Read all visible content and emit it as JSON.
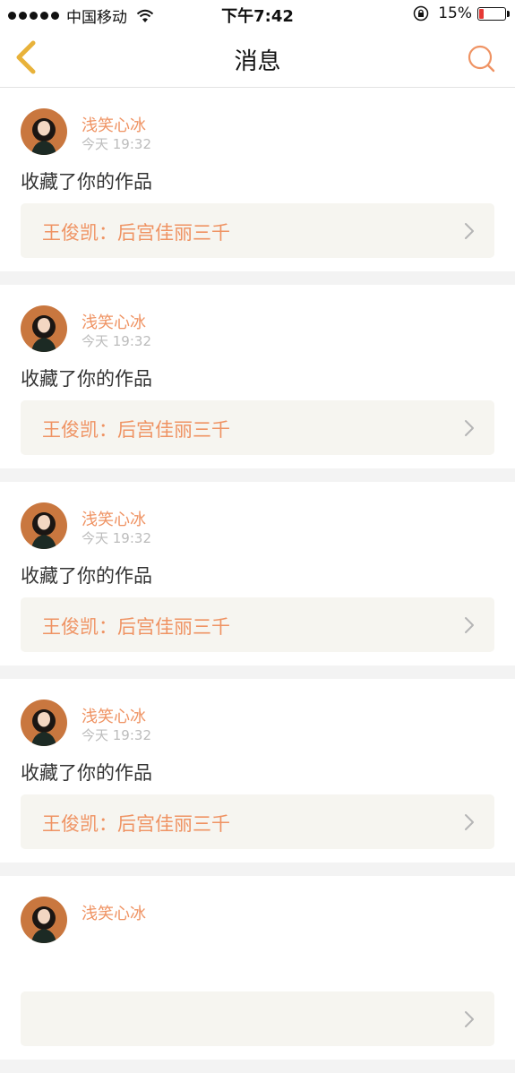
{
  "status_bar": {
    "carrier": "中国移动",
    "time": "下午7:42",
    "battery_percent": "15%",
    "battery_level": 0.15,
    "battery_color": "#e53935"
  },
  "nav": {
    "title": "消息",
    "back_icon": "chevron-left-icon",
    "search_icon": "search-icon",
    "back_color": "#e8b23a",
    "search_color": "#ef9363"
  },
  "accent_color": "#ef9363",
  "messages": [
    {
      "user": "浅笑心冰",
      "time": "今天 19:32",
      "action": "收藏了你的作品",
      "work": "王俊凯：后宫佳丽三千"
    },
    {
      "user": "浅笑心冰",
      "time": "今天 19:32",
      "action": "收藏了你的作品",
      "work": "王俊凯：后宫佳丽三千"
    },
    {
      "user": "浅笑心冰",
      "time": "今天 19:32",
      "action": "收藏了你的作品",
      "work": "王俊凯：后宫佳丽三千"
    },
    {
      "user": "浅笑心冰",
      "time": "今天 19:32",
      "action": "收藏了你的作品",
      "work": "王俊凯：后宫佳丽三千"
    },
    {
      "user": "浅笑心冰",
      "time": "",
      "action": "",
      "work": ""
    }
  ]
}
